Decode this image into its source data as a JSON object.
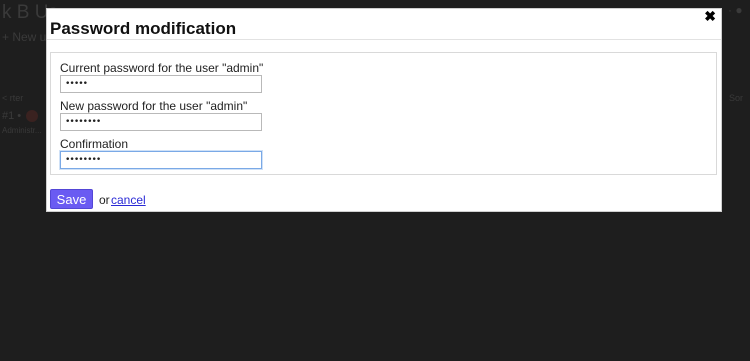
{
  "background": {
    "title_fragment": "k B Us",
    "new_fragment": "+ New u",
    "filter_fragment": "< rter",
    "row_id": "#1 •",
    "row_role": "Administr...",
    "sort_fragment": "Sor",
    "right_ctrl": "· ●"
  },
  "modal": {
    "title": "Password modification",
    "close_symbol": "✖",
    "fields": [
      {
        "label": "Current password for the user \"admin\"",
        "value": "•••••"
      },
      {
        "label": "New password for the user \"admin\"",
        "value": "••••••••"
      },
      {
        "label": "Confirmation",
        "value": "••••••••"
      }
    ],
    "save_label": "Save",
    "or_label": "or",
    "cancel_label": "cancel"
  },
  "colors": {
    "overlay": "#1e1e1e",
    "save_button": "#6a5bf2",
    "link": "#2a2ad6",
    "focus_border": "#7aa9e6"
  }
}
